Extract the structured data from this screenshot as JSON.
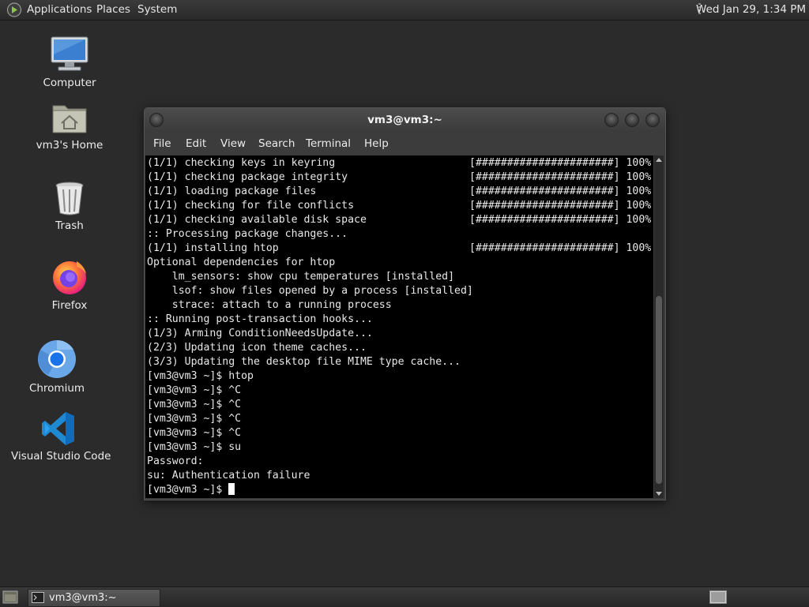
{
  "top_panel": {
    "menus": [
      "Applications",
      "Places",
      "System"
    ],
    "clock": "Wed Jan 29, 1:34 PM"
  },
  "desktop": {
    "icons": [
      {
        "label": "Computer",
        "icon": "computer-icon"
      },
      {
        "label": "vm3's Home",
        "icon": "home-folder-icon"
      },
      {
        "label": "Trash",
        "icon": "trash-icon"
      },
      {
        "label": "Firefox",
        "icon": "firefox-icon"
      },
      {
        "label": "Chromium",
        "icon": "chromium-icon"
      },
      {
        "label": "Visual Studio Code",
        "icon": "vscode-icon"
      }
    ]
  },
  "terminal": {
    "title": "vm3@vm3:~",
    "menu": [
      "File",
      "Edit",
      "View",
      "Search",
      "Terminal",
      "Help"
    ],
    "progress_bar": "[######################] 100%",
    "lines": [
      {
        "text": "(1/1) checking keys in keyring",
        "progress": true
      },
      {
        "text": "(1/1) checking package integrity",
        "progress": true
      },
      {
        "text": "(1/1) loading package files",
        "progress": true
      },
      {
        "text": "(1/1) checking for file conflicts",
        "progress": true
      },
      {
        "text": "(1/1) checking available disk space",
        "progress": true
      },
      {
        "text": ":: Processing package changes...",
        "progress": false
      },
      {
        "text": "(1/1) installing htop",
        "progress": true
      },
      {
        "text": "Optional dependencies for htop",
        "progress": false
      },
      {
        "text": "    lm_sensors: show cpu temperatures [installed]",
        "progress": false
      },
      {
        "text": "    lsof: show files opened by a process [installed]",
        "progress": false
      },
      {
        "text": "    strace: attach to a running process",
        "progress": false
      },
      {
        "text": ":: Running post-transaction hooks...",
        "progress": false
      },
      {
        "text": "(1/3) Arming ConditionNeedsUpdate...",
        "progress": false
      },
      {
        "text": "(2/3) Updating icon theme caches...",
        "progress": false
      },
      {
        "text": "(3/3) Updating the desktop file MIME type cache...",
        "progress": false
      },
      {
        "text": "[vm3@vm3 ~]$ htop",
        "progress": false
      },
      {
        "text": "[vm3@vm3 ~]$ ^C",
        "progress": false
      },
      {
        "text": "[vm3@vm3 ~]$ ^C",
        "progress": false
      },
      {
        "text": "[vm3@vm3 ~]$ ^C",
        "progress": false
      },
      {
        "text": "[vm3@vm3 ~]$ ^C",
        "progress": false
      },
      {
        "text": "[vm3@vm3 ~]$ su",
        "progress": false
      },
      {
        "text": "Password:",
        "progress": false
      },
      {
        "text": "su: Authentication failure",
        "progress": false
      }
    ],
    "prompt": "[vm3@vm3 ~]$ "
  },
  "taskbar": {
    "window_button": "vm3@vm3:~"
  }
}
